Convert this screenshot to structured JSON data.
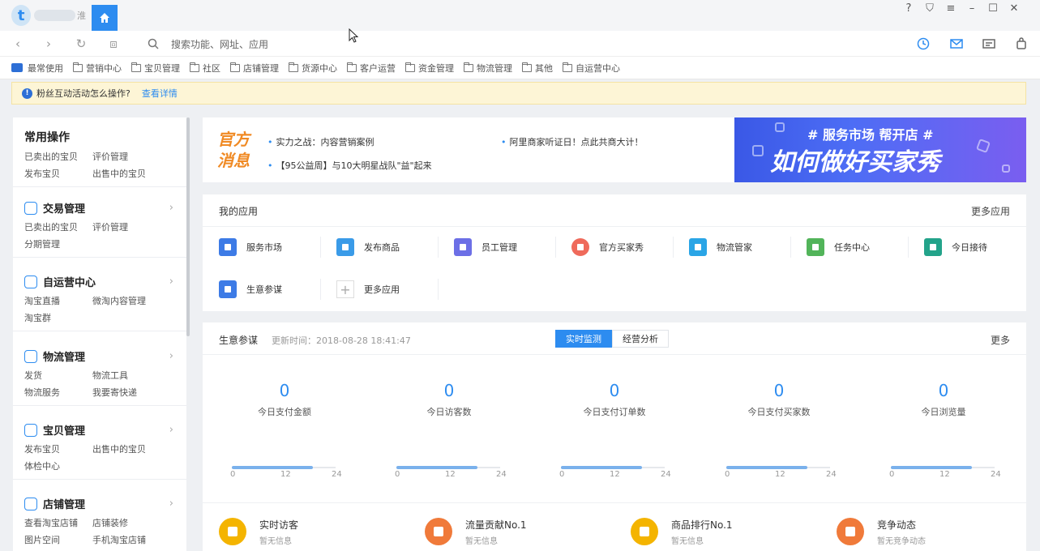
{
  "titlebar": {
    "logo_tail": "淮",
    "icons": [
      "help-icon",
      "skin-icon",
      "menu-icon",
      "minimize-icon",
      "maximize-icon",
      "close-icon"
    ]
  },
  "navbar": {
    "address_placeholder": "搜索功能、网址、应用"
  },
  "bookmarks": {
    "first": "最常使用",
    "items": [
      "营销中心",
      "宝贝管理",
      "社区",
      "店铺管理",
      "货源中心",
      "客户运营",
      "资金管理",
      "物流管理",
      "其他",
      "自运营中心"
    ]
  },
  "notice": {
    "text": "粉丝互动活动怎么操作?",
    "link": "查看详情"
  },
  "sidebar": {
    "common": {
      "title": "常用操作",
      "links": [
        "已卖出的宝贝",
        "评价管理",
        "发布宝贝",
        "出售中的宝贝"
      ]
    },
    "sections": [
      {
        "title": "交易管理",
        "links": [
          "已卖出的宝贝",
          "评价管理",
          "分期管理"
        ]
      },
      {
        "title": "自运营中心",
        "links": [
          "淘宝直播",
          "微淘内容管理",
          "淘宝群"
        ]
      },
      {
        "title": "物流管理",
        "links": [
          "发货",
          "物流工具",
          "物流服务",
          "我要寄快递"
        ]
      },
      {
        "title": "宝贝管理",
        "links": [
          "发布宝贝",
          "出售中的宝贝",
          "体检中心"
        ]
      },
      {
        "title": "店铺管理",
        "links": [
          "查看淘宝店铺",
          "店铺装修",
          "图片空间",
          "手机淘宝店铺"
        ]
      }
    ]
  },
  "news": {
    "brand_line1": "官方",
    "brand_line2": "消息",
    "items": [
      "实力之战：内容营销案例",
      "阿里商家听证日！点此共商大计！",
      "【95公益周】与10大明星战队\"益\"起来"
    ],
    "banner_line1": "# 服务市场 帮开店 #",
    "banner_line2": "如何做好买家秀"
  },
  "apps": {
    "title": "我的应用",
    "more": "更多应用",
    "items": [
      {
        "label": "服务市场",
        "color": "#3d7be6"
      },
      {
        "label": "发布商品",
        "color": "#3a9be8"
      },
      {
        "label": "员工管理",
        "color": "#6c6fe6"
      },
      {
        "label": "官方买家秀",
        "color": "#ef6a5b"
      },
      {
        "label": "物流管家",
        "color": "#2aa5e6"
      },
      {
        "label": "任务中心",
        "color": "#52b45a"
      },
      {
        "label": "今日接待",
        "color": "#23a38a"
      },
      {
        "label": "生意参谋",
        "color": "#3d7be6"
      },
      {
        "label": "更多应用",
        "color": ""
      }
    ]
  },
  "biz": {
    "title": "生意参谋",
    "updated": "更新时间：2018-08-28 18:41:47",
    "tab_realtime": "实时监测",
    "tab_analysis": "经营分析",
    "more": "更多",
    "stats": [
      {
        "value": "0",
        "label": "今日支付金额"
      },
      {
        "value": "0",
        "label": "今日访客数"
      },
      {
        "value": "0",
        "label": "今日支付订单数"
      },
      {
        "value": "0",
        "label": "今日支付买家数"
      },
      {
        "value": "0",
        "label": "今日浏览量"
      }
    ],
    "ticks": [
      "0",
      "12",
      "24"
    ],
    "progress_fraction": 0.78
  },
  "bottom": {
    "items": [
      {
        "title": "实时访客",
        "sub": "暂无信息",
        "color": "#f4b400"
      },
      {
        "title": "流量贡献No.1",
        "sub": "暂无信息",
        "color": "#f07a3a"
      },
      {
        "title": "商品排行No.1",
        "sub": "暂无信息",
        "color": "#f4b400"
      },
      {
        "title": "竞争动态",
        "sub": "暂无竞争动态",
        "color": "#f07a3a"
      }
    ]
  }
}
